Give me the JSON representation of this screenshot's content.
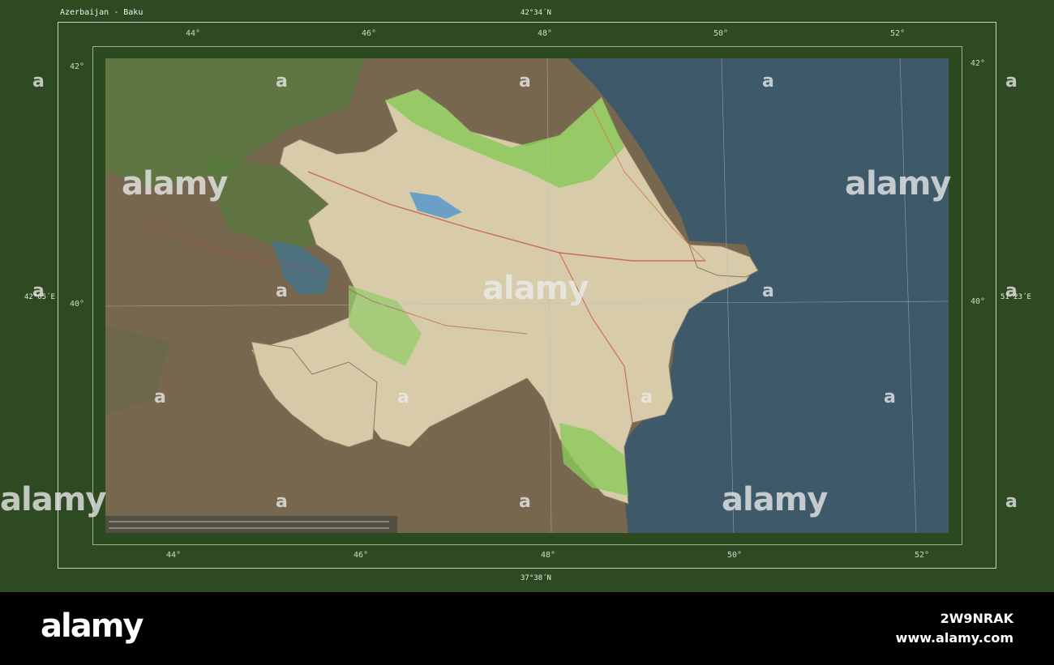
{
  "map": {
    "title": "Azerbaijan - Baku",
    "top_label": "42°34´N",
    "bottom_label": "37°38´N",
    "left_label": "42°05´E",
    "right_label": "51°23´E",
    "top_ticks": [
      "44°",
      "46°",
      "48°",
      "50°",
      "52°"
    ],
    "bottom_ticks": [
      "44°",
      "46°",
      "48°",
      "50°",
      "52°"
    ],
    "left_ticks": [
      "42°",
      "40°"
    ],
    "right_ticks": [
      "42°",
      "40°"
    ],
    "colors": {
      "frame": "#2e4a22",
      "water": "#3d5a6b",
      "country_land": "#d8ccb0",
      "surrounding_land": "#7a6a55",
      "forest": "#5f8c3e",
      "highlight_green": "#8fce5a"
    }
  },
  "watermark": {
    "text": "alamy",
    "letter": "a"
  },
  "footer": {
    "logo": "alamy",
    "image_code": "2W9NRAK",
    "url": "www.alamy.com"
  }
}
